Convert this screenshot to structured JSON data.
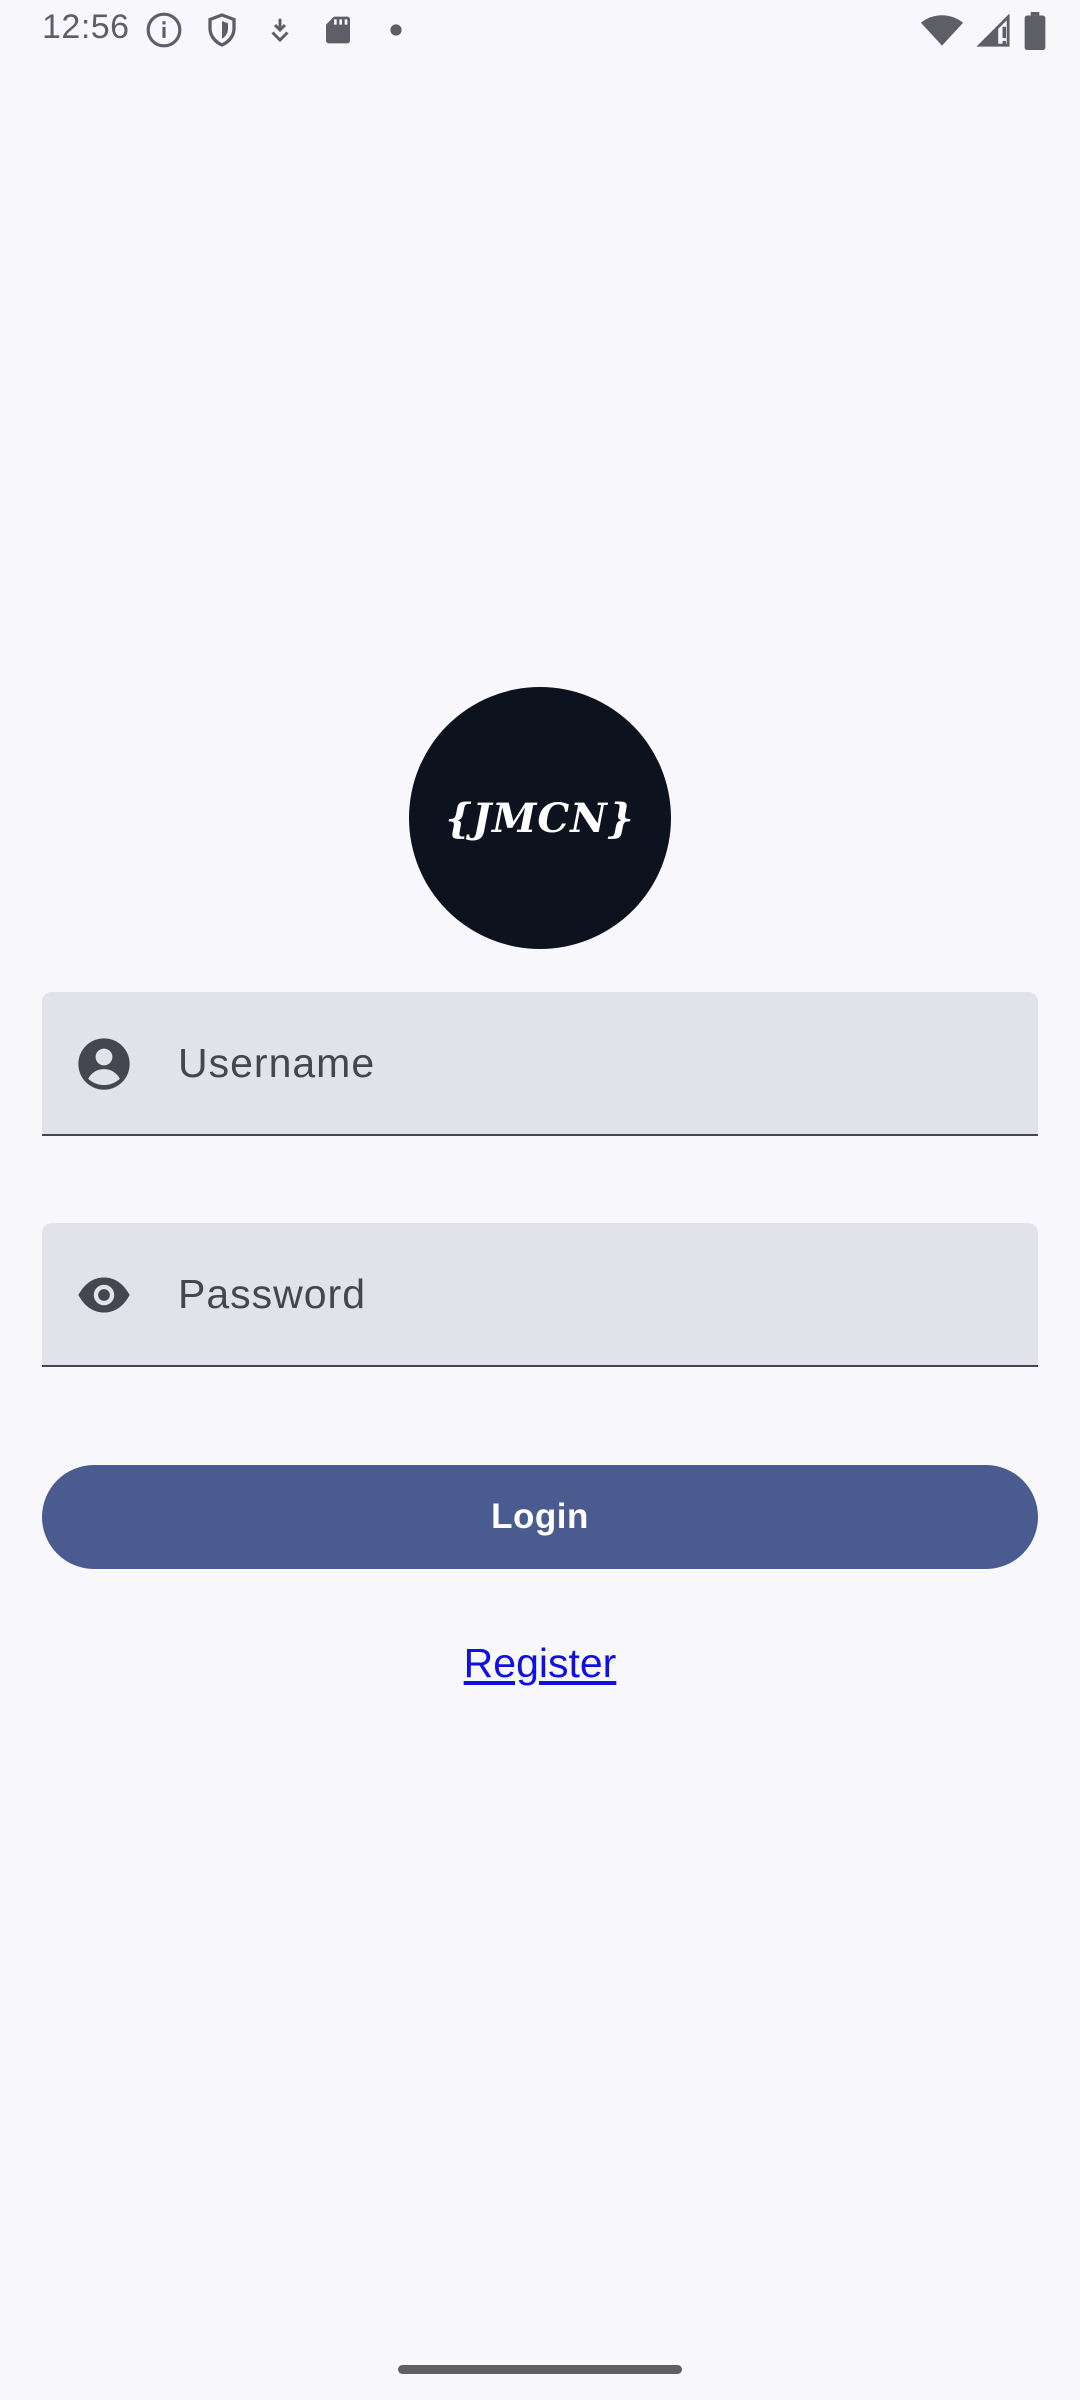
{
  "status_bar": {
    "time": "12:56",
    "left_icons": [
      "info-icon",
      "shield-icon",
      "download-icon",
      "sd-card-icon",
      "dot-icon"
    ],
    "right_icons": [
      "wifi-icon",
      "signal-icon",
      "battery-icon"
    ]
  },
  "logo": {
    "text": "{JMCN}"
  },
  "form": {
    "username_placeholder": "Username",
    "password_placeholder": "Password",
    "username_icon": "account-circle-icon",
    "password_icon": "eye-icon",
    "login_label": "Login",
    "register_label": "Register"
  },
  "colors": {
    "background": "#f8f8fc",
    "field_background": "#e2e2eb",
    "primary": "#4a5b8f",
    "logo_background": "#0c131f",
    "link": "#1010e0"
  }
}
